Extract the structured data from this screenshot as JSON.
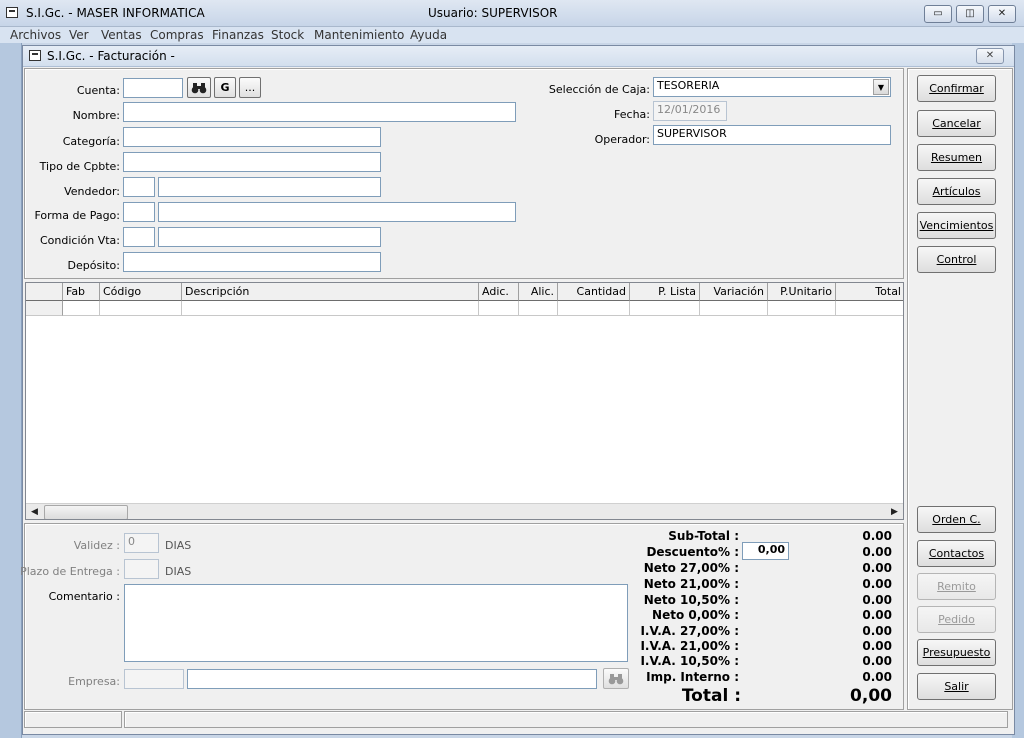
{
  "window": {
    "title": "S.I.Gc. - MASER INFORMATICA",
    "user_label": "Usuario: SUPERVISOR",
    "minimize": "▭",
    "restore": "◫",
    "close": "✕"
  },
  "menu": [
    "Archivos",
    "Ver",
    "Ventas",
    "Compras",
    "Finanzas",
    "Stock",
    "Mantenimiento",
    "Ayuda"
  ],
  "child": {
    "title": "S.I.Gc. - Facturación -",
    "close": "✕"
  },
  "form": {
    "cuenta_label": "Cuenta:",
    "cuenta_value": "",
    "g_button": "G",
    "more_button": "...",
    "nombre_label": "Nombre:",
    "categoria_label": "Categoría:",
    "tipo_label": "Tipo de Cpbte:",
    "vendedor_label": "Vendedor:",
    "forma_label": "Forma de Pago:",
    "condicion_label": "Condición Vta:",
    "deposito_label": "Depósito:",
    "caja_label": "Selección de Caja:",
    "caja_value": "TESORERIA",
    "fecha_label": "Fecha:",
    "fecha_value": "12/01/2016",
    "operador_label": "Operador:",
    "operador_value": "SUPERVISOR"
  },
  "buttons": {
    "confirmar": "Confirmar",
    "cancelar": "Cancelar",
    "resumen": "Resumen",
    "articulos": "Artículos",
    "vencimientos": "Vencimientos",
    "control": "Control",
    "orden": "Orden C.",
    "contactos": "Contactos",
    "remito": "Remito",
    "pedido": "Pedido",
    "presupuesto": "Presupuesto",
    "salir": "Salir"
  },
  "grid": {
    "columns": [
      "Fab",
      "Código",
      "Descripción",
      "Adic.",
      "Alic.",
      "Cantidad",
      "P. Lista",
      "Variación",
      "P.Unitario",
      "Total"
    ],
    "scroll_left": "◀",
    "scroll_right": "▶"
  },
  "bottom": {
    "validez_label": "Validez :",
    "validez_value": "0",
    "dias1": "DIAS",
    "plazo_label": "Plazo de Entrega :",
    "dias2": "DIAS",
    "comentario_label": "Comentario :",
    "empresa_label": "Empresa:"
  },
  "totals": {
    "subtotal_label": "Sub-Total :",
    "subtotal_value": "0.00",
    "descuento_label": "Descuento% :",
    "descuento_input": "0,00",
    "descuento_value": "0.00",
    "neto27_label": "Neto 27,00% :",
    "neto27_value": "0.00",
    "neto21_label": "Neto 21,00% :",
    "neto21_value": "0.00",
    "neto105_label": "Neto 10,50% :",
    "neto105_value": "0.00",
    "neto0_label": "Neto 0,00% :",
    "neto0_value": "0.00",
    "iva27_label": "I.V.A. 27,00% :",
    "iva27_value": "0.00",
    "iva21_label": "I.V.A. 21,00% :",
    "iva21_value": "0.00",
    "iva105_label": "I.V.A. 10,50% :",
    "iva105_value": "0.00",
    "impint_label": "Imp. Interno :",
    "impint_value": "0.00",
    "total_label": "Total :",
    "total_value": "0,00"
  }
}
